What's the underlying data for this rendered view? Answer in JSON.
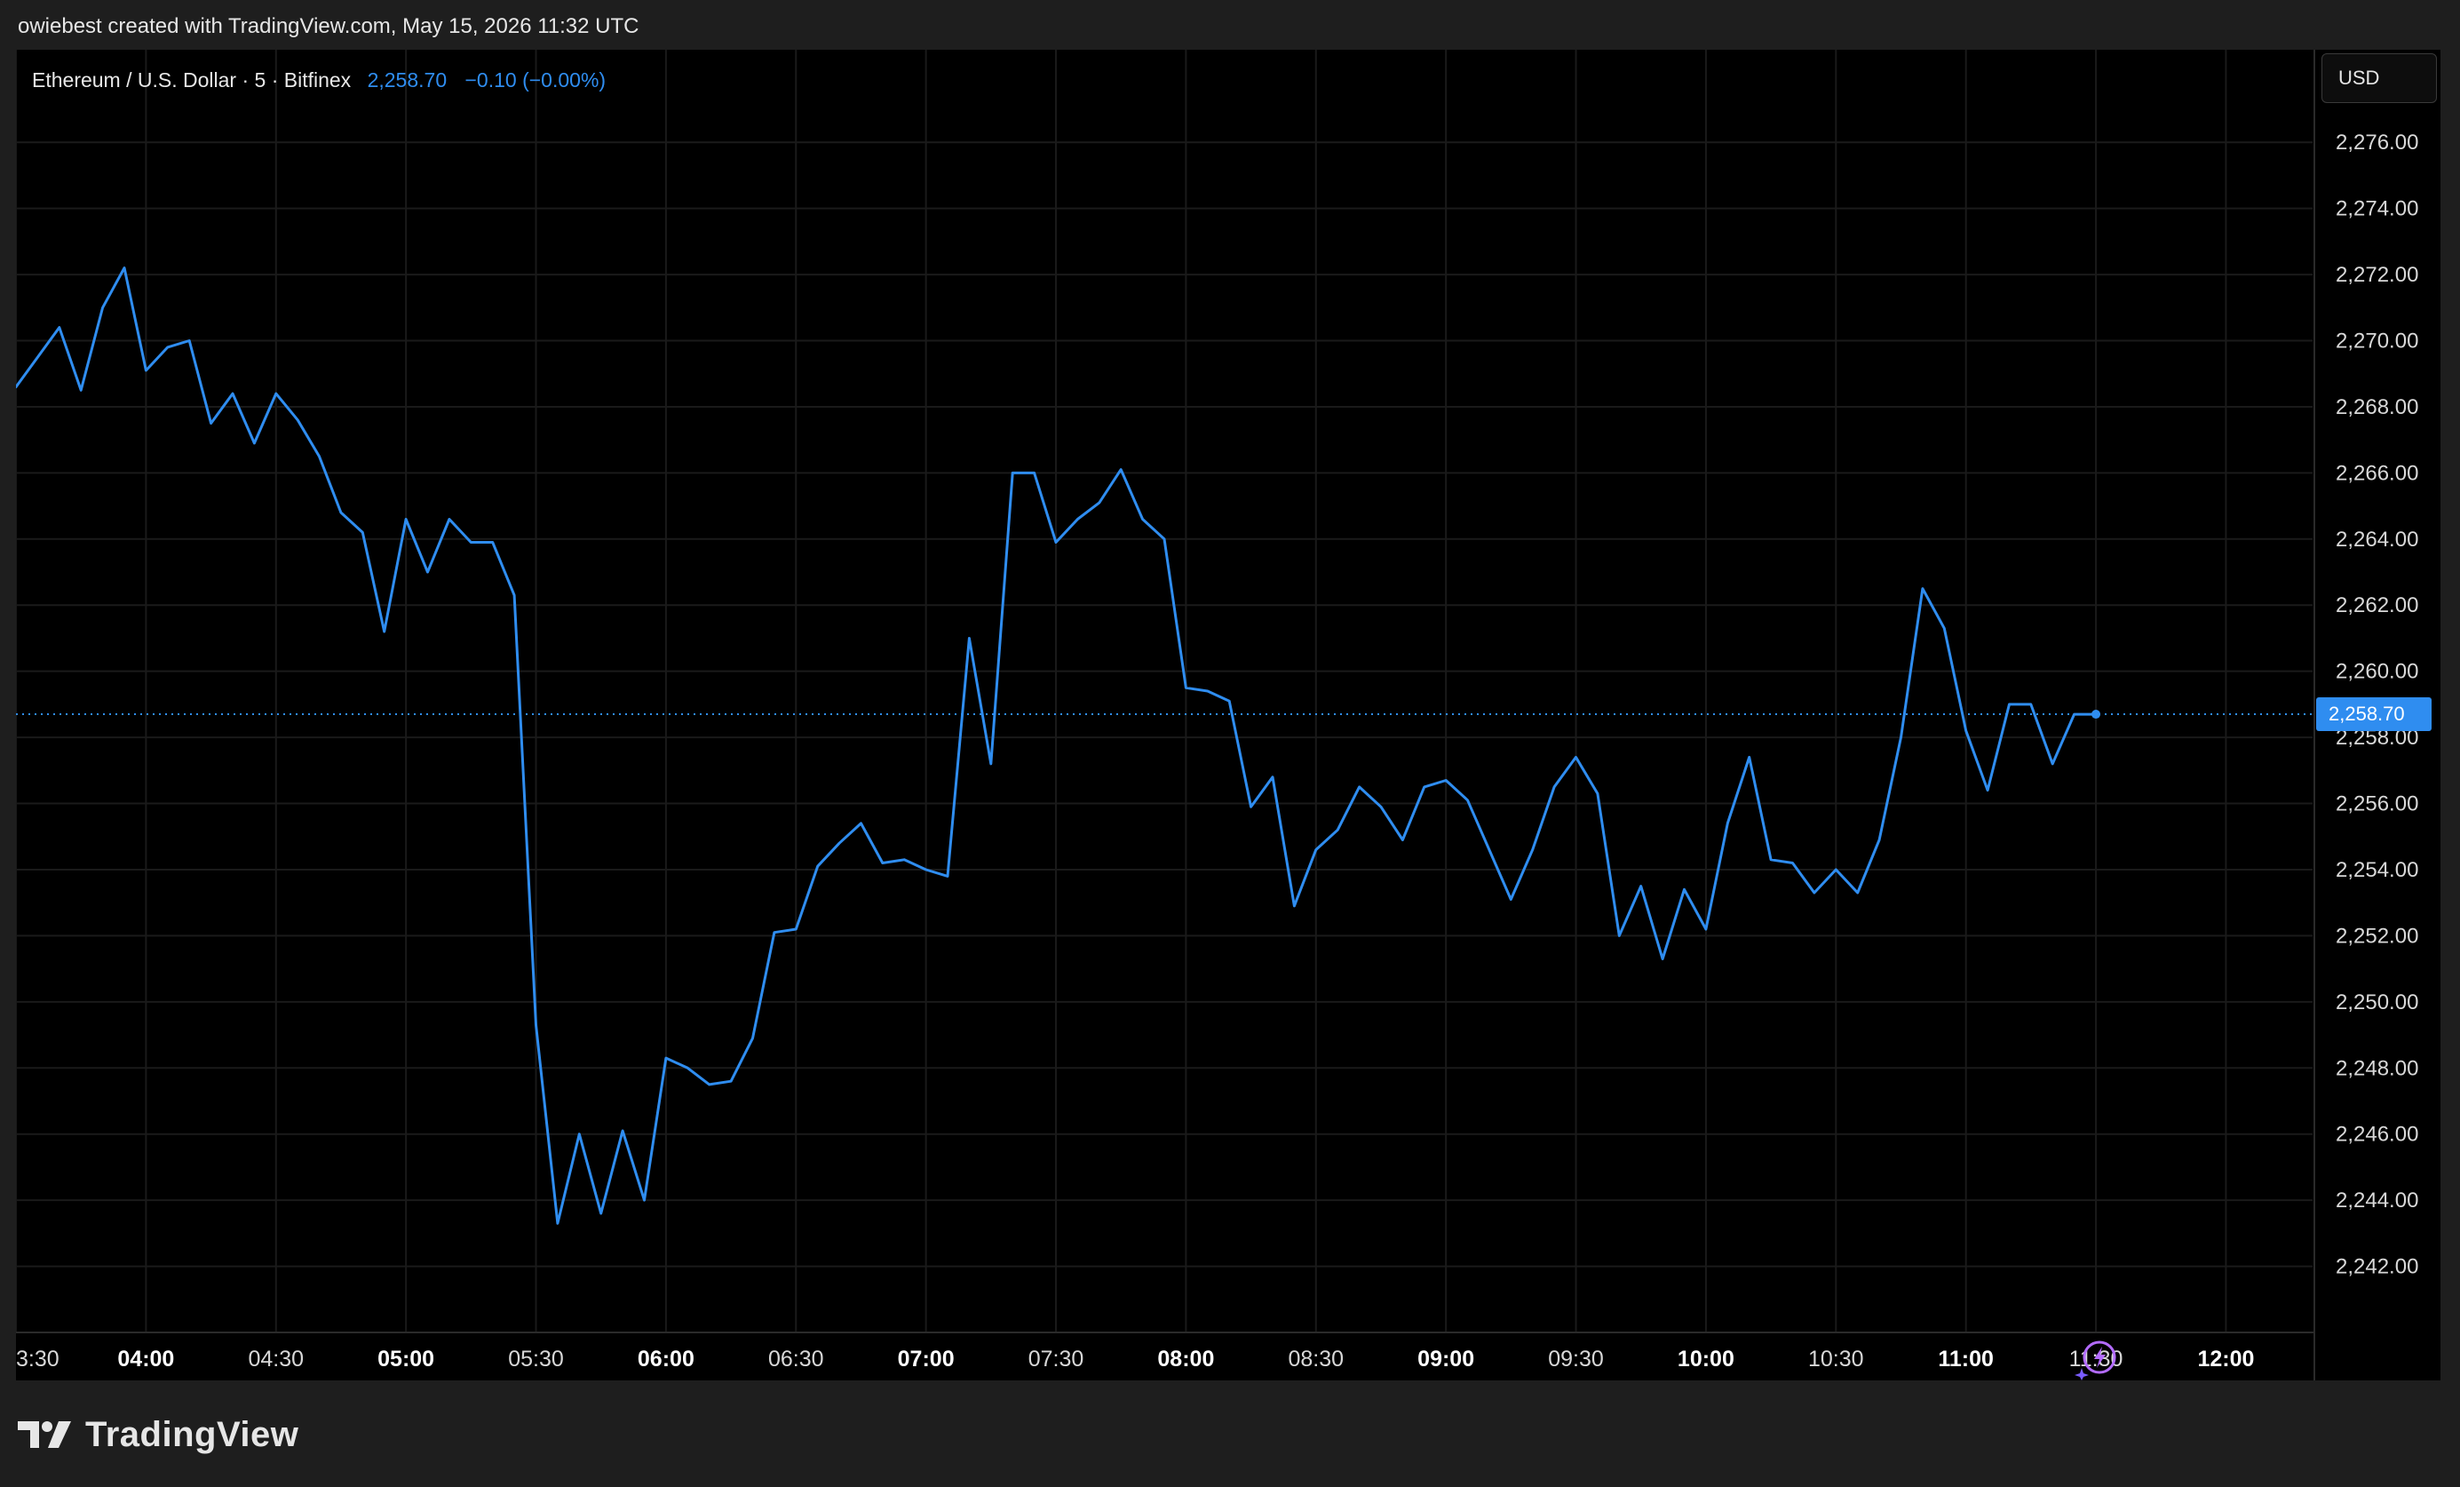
{
  "header": {
    "attribution": "owiebest created with TradingView.com, May 15, 2026 11:32 UTC"
  },
  "legend": {
    "symbol": "Ethereum / U.S. Dollar · 5 · Bitfinex",
    "last_price": "2,258.70",
    "change": "−0.10 (−0.00%)"
  },
  "currency_button": {
    "label": "USD"
  },
  "last_price_tag": {
    "label": "2,258.70"
  },
  "footer": {
    "brand": "TradingView"
  },
  "icons": {
    "logo": "tradingview-logo-icon",
    "bolt": "lightning-bolt-icon"
  },
  "colors": {
    "line": "#2f8df0",
    "grid": "#1a1a1a",
    "background": "#000000",
    "axis_text": "#d8d8d8",
    "bolt": "#b36bff"
  },
  "chart_data": {
    "type": "line",
    "title": "Ethereum / U.S. Dollar · 5 · Bitfinex",
    "xlabel": "",
    "ylabel": "",
    "grid": true,
    "y_ticks": [
      "2,242.00",
      "2,244.00",
      "2,246.00",
      "2,248.00",
      "2,250.00",
      "2,252.00",
      "2,254.00",
      "2,256.00",
      "2,258.00",
      "2,260.00",
      "2,262.00",
      "2,264.00",
      "2,266.00",
      "2,268.00",
      "2,270.00",
      "2,272.00",
      "2,274.00",
      "2,276.00"
    ],
    "y_tick_values": [
      2242,
      2244,
      2246,
      2248,
      2250,
      2252,
      2254,
      2256,
      2258,
      2260,
      2262,
      2264,
      2266,
      2268,
      2270,
      2272,
      2274,
      2276
    ],
    "ylim": [
      2240.0,
      2278.8
    ],
    "x_ticks": [
      {
        "t": "03:30",
        "label": "3:30",
        "bold": false
      },
      {
        "t": "04:00",
        "label": "04:00",
        "bold": true
      },
      {
        "t": "04:30",
        "label": "04:30",
        "bold": false
      },
      {
        "t": "05:00",
        "label": "05:00",
        "bold": true
      },
      {
        "t": "05:30",
        "label": "05:30",
        "bold": false
      },
      {
        "t": "06:00",
        "label": "06:00",
        "bold": true
      },
      {
        "t": "06:30",
        "label": "06:30",
        "bold": false
      },
      {
        "t": "07:00",
        "label": "07:00",
        "bold": true
      },
      {
        "t": "07:30",
        "label": "07:30",
        "bold": false
      },
      {
        "t": "08:00",
        "label": "08:00",
        "bold": true
      },
      {
        "t": "08:30",
        "label": "08:30",
        "bold": false
      },
      {
        "t": "09:00",
        "label": "09:00",
        "bold": true
      },
      {
        "t": "09:30",
        "label": "09:30",
        "bold": false
      },
      {
        "t": "10:00",
        "label": "10:00",
        "bold": true
      },
      {
        "t": "10:30",
        "label": "10:30",
        "bold": false
      },
      {
        "t": "11:00",
        "label": "11:00",
        "bold": true
      },
      {
        "t": "11:30",
        "label": "11:30",
        "bold": false
      },
      {
        "t": "12:00",
        "label": "12:00",
        "bold": true
      }
    ],
    "xlim": [
      "03:30",
      "12:20"
    ],
    "last_value": 2258.7,
    "series": [
      {
        "x": [
          "03:30",
          "03:35",
          "03:40",
          "03:45",
          "03:50",
          "03:55",
          "04:00",
          "04:05",
          "04:10",
          "04:15",
          "04:20",
          "04:25",
          "04:30",
          "04:35",
          "04:40",
          "04:45",
          "04:50",
          "04:55",
          "05:00",
          "05:05",
          "05:10",
          "05:15",
          "05:20",
          "05:25",
          "05:30",
          "05:35",
          "05:40",
          "05:45",
          "05:50",
          "05:55",
          "06:00",
          "06:05",
          "06:10",
          "06:15",
          "06:20",
          "06:25",
          "06:30",
          "06:35",
          "06:40",
          "06:45",
          "06:50",
          "06:55",
          "07:00",
          "07:05",
          "07:10",
          "07:15",
          "07:20",
          "07:25",
          "07:30",
          "07:35",
          "07:40",
          "07:45",
          "07:50",
          "07:55",
          "08:00",
          "08:05",
          "08:10",
          "08:15",
          "08:20",
          "08:25",
          "08:30",
          "08:35",
          "08:40",
          "08:45",
          "08:50",
          "08:55",
          "09:00",
          "09:05",
          "09:10",
          "09:15",
          "09:20",
          "09:25",
          "09:30",
          "09:35",
          "09:40",
          "09:45",
          "09:50",
          "09:55",
          "10:00",
          "10:05",
          "10:10",
          "10:15",
          "10:20",
          "10:25",
          "10:30",
          "10:35",
          "10:40",
          "10:45",
          "10:50",
          "10:55",
          "11:00",
          "11:05",
          "11:10",
          "11:15",
          "11:20",
          "11:25",
          "11:30"
        ],
        "values": [
          2268.6,
          2269.5,
          2270.4,
          2268.5,
          2271.0,
          2272.2,
          2269.1,
          2269.8,
          2270.0,
          2267.5,
          2268.4,
          2266.9,
          2268.4,
          2267.6,
          2266.5,
          2264.8,
          2264.2,
          2261.2,
          2264.6,
          2263.0,
          2264.6,
          2263.9,
          2263.9,
          2262.3,
          2249.3,
          2243.3,
          2246.0,
          2243.6,
          2246.1,
          2244.0,
          2248.3,
          2248.0,
          2247.5,
          2247.6,
          2248.9,
          2252.1,
          2252.2,
          2254.1,
          2254.8,
          2255.4,
          2254.2,
          2254.3,
          2254.0,
          2253.8,
          2261.0,
          2257.2,
          2266.0,
          2266.0,
          2263.9,
          2264.6,
          2265.1,
          2266.1,
          2264.6,
          2264.0,
          2259.5,
          2259.4,
          2259.1,
          2255.9,
          2256.8,
          2252.9,
          2254.6,
          2255.2,
          2256.5,
          2255.9,
          2254.9,
          2256.5,
          2256.7,
          2256.1,
          2254.6,
          2253.1,
          2254.6,
          2256.5,
          2257.4,
          2256.3,
          2252.0,
          2253.5,
          2251.3,
          2253.4,
          2252.2,
          2255.4,
          2257.4,
          2254.3,
          2254.2,
          2253.3,
          2254.0,
          2253.3,
          2254.9,
          2258.0,
          2262.5,
          2261.3,
          2258.2,
          2256.4,
          2259.0,
          2259.0,
          2257.2,
          2258.7,
          2258.7
        ]
      }
    ]
  }
}
